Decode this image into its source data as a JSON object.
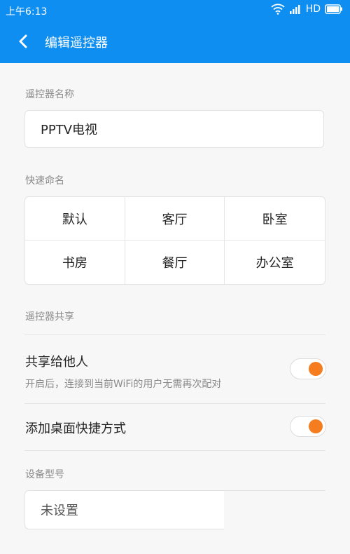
{
  "status": {
    "time": "上午6:13",
    "network": "HD"
  },
  "header": {
    "title": "编辑遥控器"
  },
  "name_section": {
    "label": "遥控器名称",
    "value": "PPTV电视"
  },
  "quick_names": {
    "label": "快速命名",
    "items": [
      "默认",
      "客厅",
      "卧室",
      "书房",
      "餐厅",
      "办公室"
    ]
  },
  "share_section": {
    "label": "遥控器共享"
  },
  "share": {
    "title": "共享给他人",
    "desc": "开启后，连接到当前WiFi的用户无需再次配对",
    "enabled": true
  },
  "shortcut": {
    "title": "添加桌面快捷方式",
    "enabled": true
  },
  "model_section": {
    "label": "设备型号",
    "placeholder": "未设置"
  },
  "colors": {
    "accent": "#0d8ef0",
    "toggle_on": "#f57c1f"
  }
}
